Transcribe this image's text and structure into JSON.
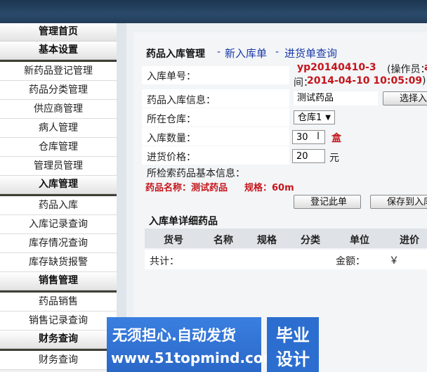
{
  "sidebar": {
    "s0": "管理首页",
    "s1": "基本设置",
    "i1": [
      "新药品登记管理",
      "药品分类管理",
      "供应商管理",
      "病人管理",
      "仓库管理",
      "管理员管理"
    ],
    "s2": "入库管理",
    "i2": [
      "药品入库",
      "入库记录查询",
      "库存情况查询",
      "库存缺货报警"
    ],
    "s3": "销售管理",
    "i3": [
      "药品销售",
      "销售记录查询"
    ],
    "s4": "财务查询",
    "i4": [
      "财务查询"
    ]
  },
  "header": {
    "title": "药品入库管理",
    "sep1": "-",
    "link_new": "新入库单",
    "sep2": "-",
    "link_query": "进货单查询"
  },
  "form": {
    "order_no_label": "入库单号：",
    "order_no": "yp20140410-3",
    "operator_partial": "(操作员：",
    "operator_edge": "a",
    "time_prefix": "间：",
    "time_value": "2014-04-10 10:05:09",
    "time_close": ")",
    "drug_info_label": "药品入库信息：",
    "drug_name_value": "测试药品",
    "select_button": "选择入库",
    "warehouse_label": "所在仓库：",
    "warehouse_value": "仓库1",
    "qty_label": "入库数量：",
    "qty_value": "30",
    "qty_unit": "盒",
    "price_label": "进货价格：",
    "price_value": "20",
    "price_unit": "元",
    "basic_info_label": "所检索药品基本信息：",
    "found_drug": "药品名称：测试药品",
    "found_spec": "规格：60m",
    "register_button": "登记此单",
    "save_button": "保存到入库"
  },
  "detail": {
    "title": "入库单详细药品",
    "columns": [
      "货号",
      "名称",
      "规格",
      "分类",
      "单位",
      "进价"
    ],
    "total_label": "共计：",
    "amount_label": "金额：",
    "amount_value": "￥"
  },
  "ad": {
    "line1": "无须担心.自动发货",
    "line2": "www.51topmind.com",
    "box_line1": "毕业",
    "box_line2": "设计"
  },
  "colors": {
    "topbar": "#213c58",
    "link": "#1a3aa8",
    "highlight": "#c4161c",
    "ad_bg": "#2c6ed0"
  }
}
